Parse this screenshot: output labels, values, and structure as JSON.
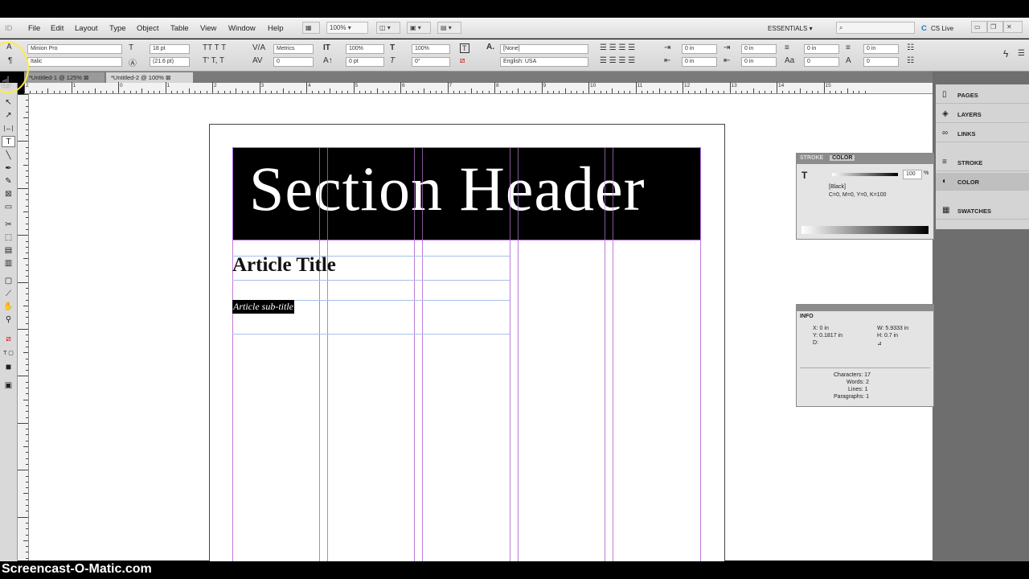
{
  "menu": [
    "File",
    "Edit",
    "Layout",
    "Type",
    "Object",
    "Table",
    "View",
    "Window",
    "Help"
  ],
  "menubar": {
    "zoom": "100%",
    "workspace": "ESSENTIALS",
    "search_placeholder": "",
    "cslive": "CS Live"
  },
  "control": {
    "font_family": "Minion Pro",
    "font_style": "Italic",
    "font_size": "18 pt",
    "leading": "(21.6 pt)",
    "kerning": "Metrics",
    "tracking": "0",
    "vscale": "100%",
    "baseline": "0 pt",
    "hscale": "100%",
    "skew": "0°",
    "char_style": "[None]",
    "language": "English: USA",
    "indent1": "0 in",
    "indent2": "0 in",
    "indent3": "0 in",
    "indent4": "0 in",
    "space1": "0 in",
    "space2": "0 in",
    "space3": "0",
    "space4": "0"
  },
  "tabs": [
    "*Untitled-1 @ 125%",
    "*Untitled-2 @ 100%"
  ],
  "ruler_numbers": [
    "2",
    "1",
    "0",
    "1",
    "2",
    "3",
    "4",
    "5",
    "6",
    "7",
    "8",
    "9",
    "10",
    "11",
    "12",
    "13",
    "14",
    "15"
  ],
  "page": {
    "header": "Section Header",
    "article_title": "Article Title",
    "article_subtitle": "Article sub-title"
  },
  "dock_items": [
    {
      "label": "PAGES",
      "icon": "pages-icon"
    },
    {
      "label": "LAYERS",
      "icon": "layers-icon"
    },
    {
      "label": "LINKS",
      "icon": "links-icon"
    },
    {
      "label": "STROKE",
      "icon": "stroke-icon"
    },
    {
      "label": "COLOR",
      "icon": "color-icon"
    },
    {
      "label": "SWATCHES",
      "icon": "swatches-icon"
    }
  ],
  "color_panel": {
    "tab1": "STROKE",
    "tab2": "COLOR",
    "tint": "100",
    "swatch_name": "[Black]",
    "values": "C=0, M=0, Y=0, K=100",
    "percent": "%"
  },
  "info_panel": {
    "title": "INFO",
    "x": "X: 0 in",
    "y": "Y: 0.1817 in",
    "d": "D:",
    "w": "W: 5.9333 in",
    "h": "H: 0.7 in",
    "angle": "⊿",
    "characters": "Characters: 17",
    "words": "Words: 2",
    "lines": "Lines: 1",
    "paragraphs": "Paragraphs: 1"
  },
  "watermark": "Screencast-O-Matic.com",
  "colors": {
    "guide": "#c17bd9",
    "margin": "#a8c0ea",
    "header_bg": "#000000"
  }
}
